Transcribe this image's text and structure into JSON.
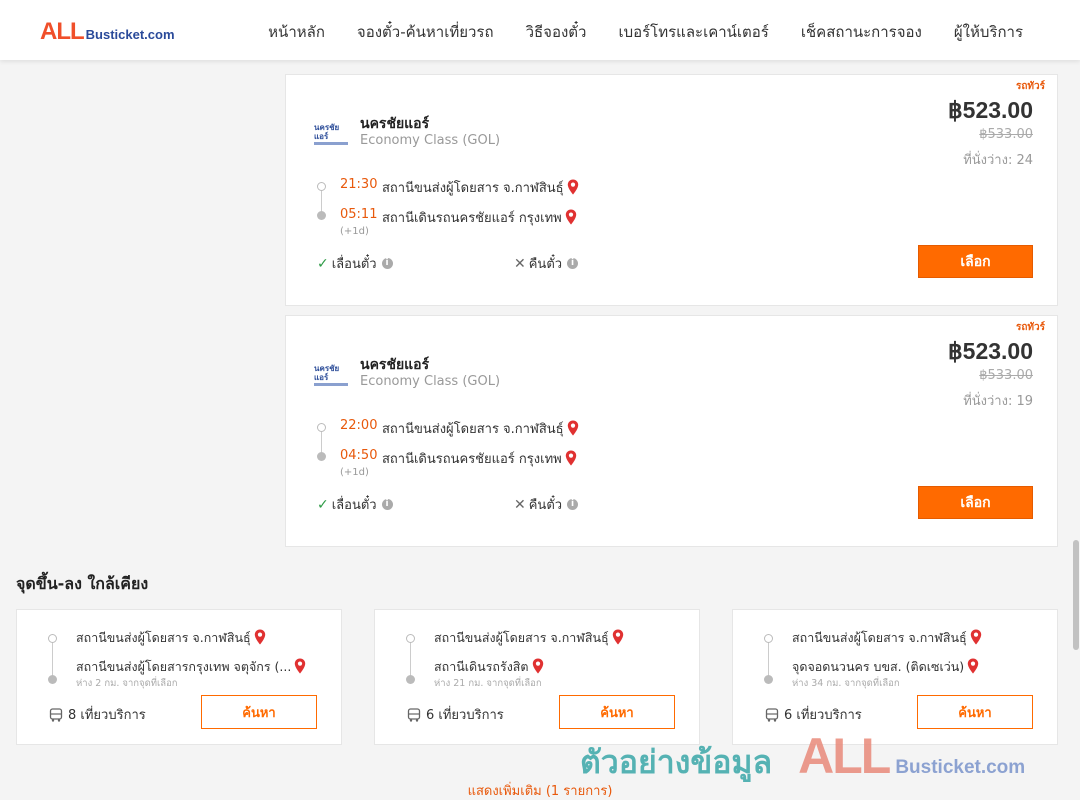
{
  "header": {
    "logo_all": "ALL",
    "logo_busticket": "Busticket.com",
    "nav": [
      "หน้าหลัก",
      "จองตั๋ว-ค้นหาเที่ยวรถ",
      "วิธีจองตั๋ว",
      "เบอร์โทรและเคาน์เตอร์",
      "เช็คสถานะการจอง",
      "ผู้ให้บริการ"
    ]
  },
  "trips": [
    {
      "ribbon": "รถทัวร์",
      "operator": "นครชัยแอร์",
      "logo_text": "นครชัยแอร์",
      "class": "Economy Class (GOL)",
      "price": "฿523.00",
      "old_price": "฿533.00",
      "seats": "ที่นั่งว่าง: 24",
      "depart_time": "21:30",
      "depart_station": "สถานีขนส่งผู้โดยสาร จ.กาฬสินธุ์",
      "arrive_time": "05:11",
      "arrive_station": "สถานีเดินรถนครชัยแอร์ กรุงเทพ",
      "plus_day": "(+1d)",
      "reschedule": "เลื่อนตั๋ว",
      "refund": "คืนตั๋ว",
      "select_label": "เลือก"
    },
    {
      "ribbon": "รถทัวร์",
      "operator": "นครชัยแอร์",
      "logo_text": "นครชัยแอร์",
      "class": "Economy Class (GOL)",
      "price": "฿523.00",
      "old_price": "฿533.00",
      "seats": "ที่นั่งว่าง: 19",
      "depart_time": "22:00",
      "depart_station": "สถานีขนส่งผู้โดยสาร จ.กาฬสินธุ์",
      "arrive_time": "04:50",
      "arrive_station": "สถานีเดินรถนครชัยแอร์ กรุงเทพ",
      "plus_day": "(+1d)",
      "reschedule": "เลื่อนตั๋ว",
      "refund": "คืนตั๋ว",
      "select_label": "เลือก"
    }
  ],
  "nearby": {
    "title": "จุดขึ้น-ลง ใกล้เคียง",
    "items": [
      {
        "from": "สถานีขนส่งผู้โดยสาร จ.กาฬสินธุ์",
        "to": "สถานีขนส่งผู้โดยสารกรุงเทพ จตุจักร (...",
        "distance": "ห่าง 2 กม. จากจุดที่เลือก",
        "trips": "8 เที่ยวบริการ",
        "search_label": "ค้นหา"
      },
      {
        "from": "สถานีขนส่งผู้โดยสาร จ.กาฬสินธุ์",
        "to": "สถานีเดินรถรังสิต",
        "distance": "ห่าง 21 กม. จากจุดที่เลือก",
        "trips": "6 เที่ยวบริการ",
        "search_label": "ค้นหา"
      },
      {
        "from": "สถานีขนส่งผู้โดยสาร จ.กาฬสินธุ์",
        "to": "จุดจอดนวนคร บขส. (ติดเซเว่น)",
        "distance": "ห่าง 34 กม. จากจุดที่เลือก",
        "trips": "6 เที่ยวบริการ",
        "search_label": "ค้นหา"
      }
    ]
  },
  "show_more": "แสดงเพิ่มเติม (1 รายการ)",
  "watermark": {
    "text": "ตัวอย่างข้อมูล",
    "all": "ALL",
    "busticket": "Busticket.com"
  },
  "colors": {
    "accent": "#ff6a00",
    "time": "#e8590c",
    "pin": "#e03131",
    "check": "#2e9b46"
  }
}
